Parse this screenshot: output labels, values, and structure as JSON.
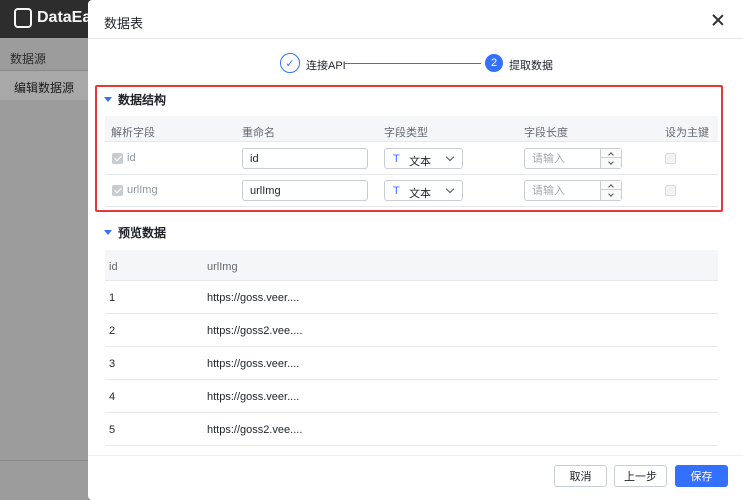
{
  "background": {
    "brand": "DataEa",
    "side_title": "数据源",
    "side_item": "编辑数据源"
  },
  "drawer": {
    "title": "数据表"
  },
  "steps": [
    {
      "label": "连接API",
      "state": "done",
      "icon": "check-icon"
    },
    {
      "label": "提取数据",
      "state": "active",
      "number": "2"
    }
  ],
  "schema": {
    "title": "数据结构",
    "headers": [
      "解析字段",
      "重命名",
      "字段类型",
      "字段长度",
      "设为主键"
    ],
    "rows": [
      {
        "field": "id",
        "checked": true,
        "rename": "id",
        "type": "文本",
        "type_icon": "T",
        "length_placeholder": "请输入",
        "primary_key": false
      },
      {
        "field": "urlImg",
        "checked": true,
        "rename": "urlImg",
        "type": "文本",
        "type_icon": "T",
        "length_placeholder": "请输入",
        "primary_key": false
      }
    ]
  },
  "preview": {
    "title": "预览数据",
    "headers": [
      "id",
      "urlImg"
    ],
    "rows": [
      [
        "1",
        "https://goss.veer...."
      ],
      [
        "2",
        "https://goss2.vee...."
      ],
      [
        "3",
        "https://goss.veer...."
      ],
      [
        "4",
        "https://goss.veer...."
      ],
      [
        "5",
        "https://goss2.vee...."
      ]
    ]
  },
  "footer": {
    "cancel": "取消",
    "prev": "上一步",
    "save": "保存"
  },
  "colors": {
    "primary": "#3370ff",
    "highlight": "#e53935"
  }
}
